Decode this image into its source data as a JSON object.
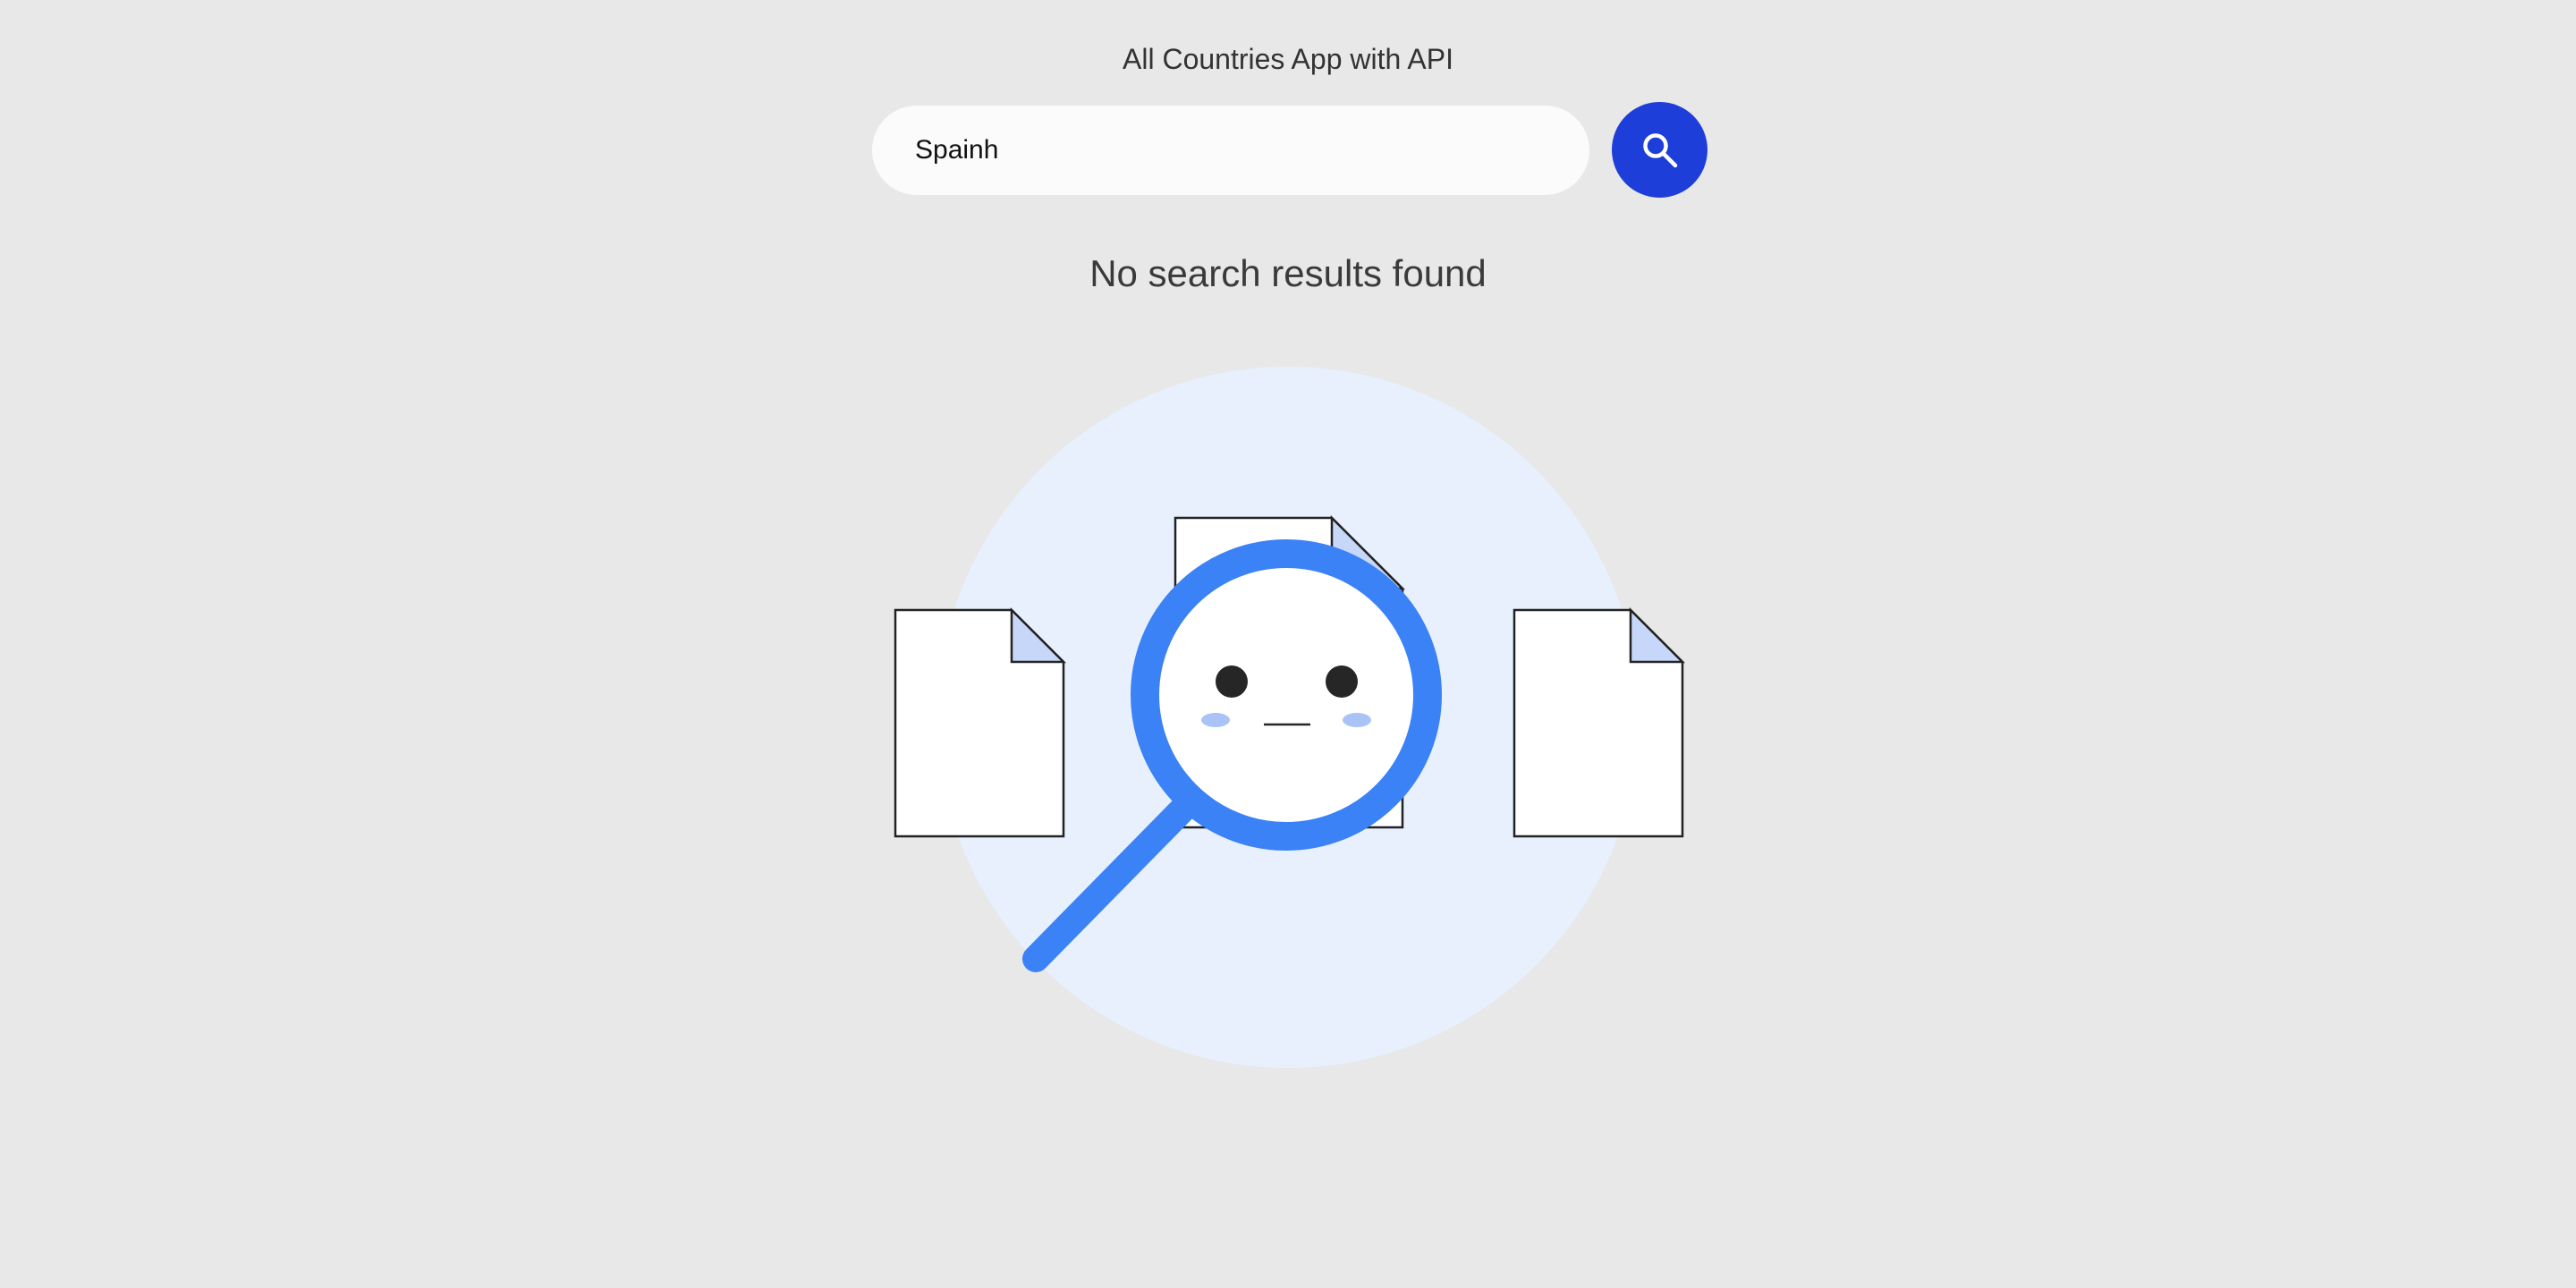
{
  "app": {
    "title": "All Countries App with API"
  },
  "search": {
    "value": "Spainh",
    "button_icon": "search-icon"
  },
  "results": {
    "message": "No search results found",
    "illustration_icon": "empty-search-illustration"
  },
  "colors": {
    "background": "#e8e8e8",
    "search_button": "#1d3ed8",
    "magnifier": "#3b82f6",
    "circle_backdrop": "#e8f0fe",
    "doc_fold": "#c7d7f9",
    "cheeks": "#a9c3f7"
  }
}
